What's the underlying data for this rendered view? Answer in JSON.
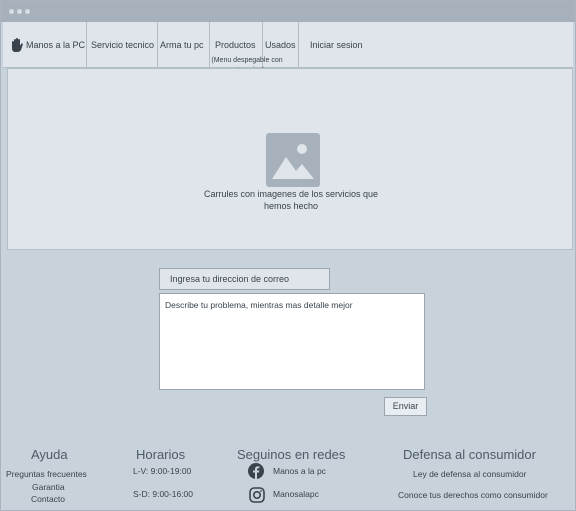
{
  "navbar": {
    "brand": "Manos a la PC",
    "items": [
      {
        "label": "Servicio tecnico"
      },
      {
        "label": "Arma tu pc"
      },
      {
        "label": "Productos",
        "note": "(Menu despegable con categorias)"
      },
      {
        "label": "Usados"
      },
      {
        "label": "Iniciar sesion"
      }
    ]
  },
  "carousel": {
    "caption": "Carrules con imagenes de los servicios que hemos hecho",
    "icon": "image-placeholder-icon"
  },
  "contact_form": {
    "email_placeholder": "Ingresa tu direccion de correo",
    "message_placeholder": "Describe tu problema, mientras mas detalle mejor",
    "send_label": "Enviar"
  },
  "footer": {
    "help": {
      "title": "Ayuda",
      "links": [
        "Preguntas frecuentes",
        "Garantia",
        "Contacto"
      ]
    },
    "hours": {
      "title": "Horarios",
      "weekdays": "L-V: 9:00-19:00",
      "weekend": "S-D: 9:00-16:00"
    },
    "social": {
      "title": "Seguinos en redes",
      "facebook": "Manos a la pc",
      "instagram": "Manosalapc"
    },
    "consumer": {
      "title": "Defensa al consumidor",
      "law": "Ley de defensa al consumidor",
      "rights": "Conoce tus derechos como consumidor"
    }
  },
  "colors": {
    "page_background": "#c8d2da",
    "panel_background": "#dfe5ea",
    "titlebar": "#a6b1bb",
    "text": "#3a434c"
  }
}
